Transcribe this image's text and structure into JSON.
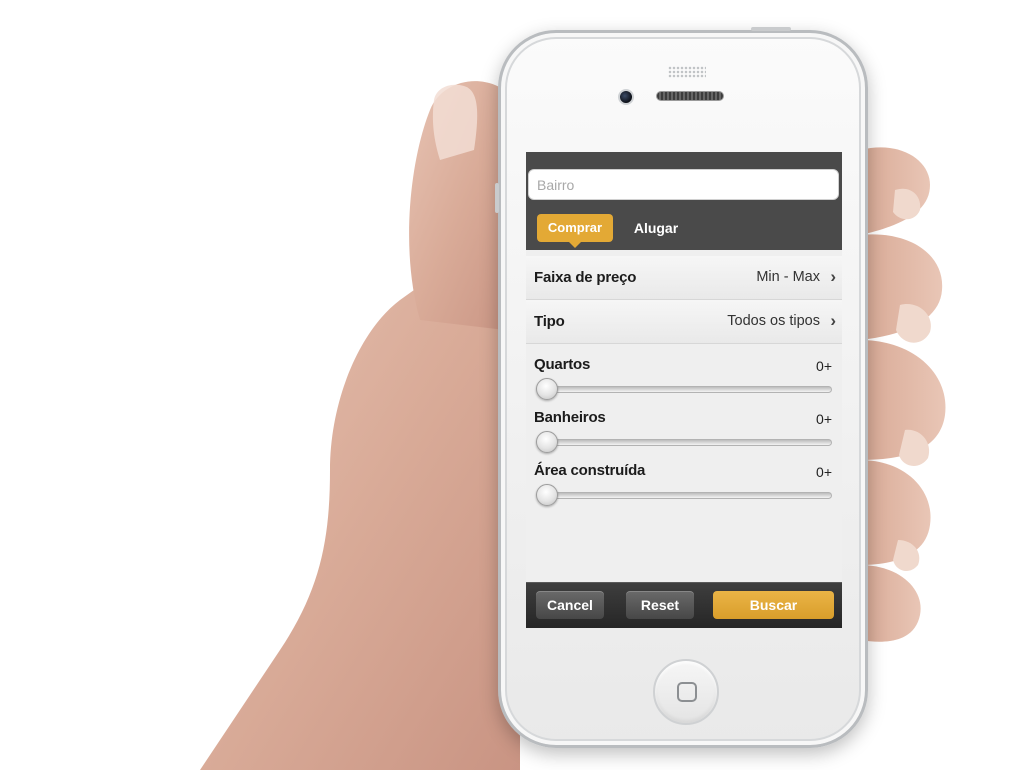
{
  "search": {
    "placeholder": "Bairro"
  },
  "tabs": [
    {
      "label": "Comprar",
      "active": true
    },
    {
      "label": "Alugar",
      "active": false
    }
  ],
  "filters": {
    "price": {
      "label": "Faixa de preço",
      "value": "Min - Max"
    },
    "type": {
      "label": "Tipo",
      "value": "Todos os tipos"
    }
  },
  "sliders": [
    {
      "label": "Quartos",
      "value": "0+"
    },
    {
      "label": "Banheiros",
      "value": "0+"
    },
    {
      "label": "Área construída",
      "value": "0+"
    }
  ],
  "actions": {
    "cancel": "Cancel",
    "reset": "Reset",
    "search": "Buscar"
  },
  "icons": {
    "chevron": "chevron-right-icon",
    "home": "home-button-icon"
  },
  "colors": {
    "accent": "#e3a935",
    "topbar": "#4a4a4a",
    "bottombar": "#2c2c2c"
  }
}
